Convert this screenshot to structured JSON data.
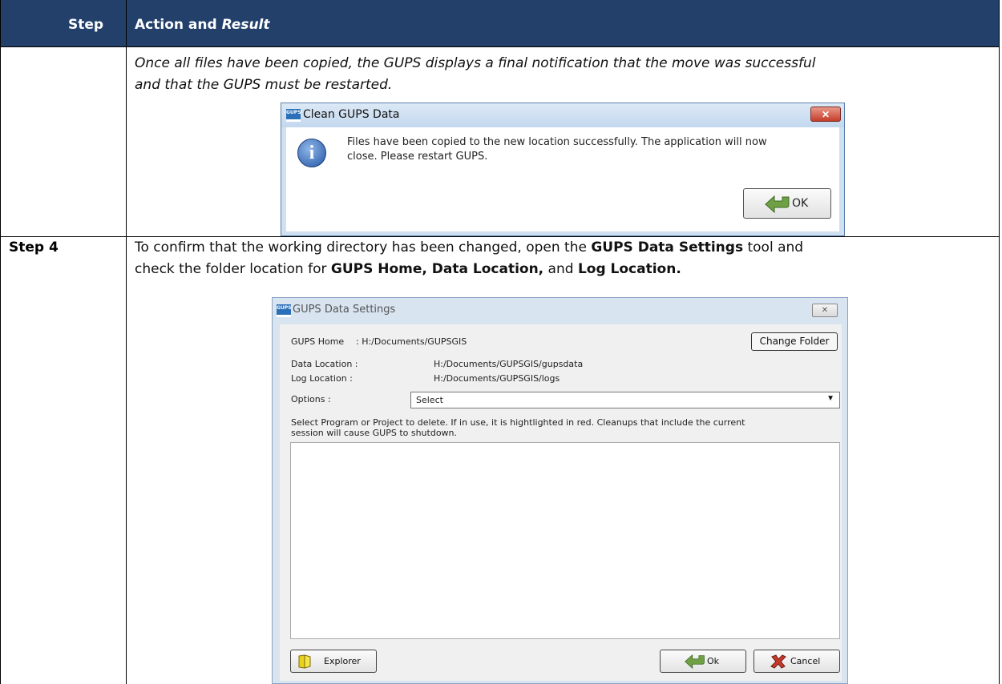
{
  "table": {
    "header": {
      "step": "Step",
      "action": "Action and",
      "result": "Result"
    },
    "row1": {
      "text_line1": "Once all files have been copied, the GUPS displays a final notification that the move was successful",
      "text_line2": "and that the GUPS must be restarted."
    },
    "row2": {
      "step": "Step 4",
      "text_line1_a": "To confirm that the working directory has been changed, open the ",
      "text_line1_b": "GUPS Data Settings",
      "text_line1_c": " tool and",
      "text_line2_a": "check the folder location for ",
      "text_line2_b": "GUPS Home, Data Location,",
      "text_line2_c": " and ",
      "text_line2_d": "Log Location."
    }
  },
  "dialog_clean": {
    "title": "Clean GUPS Data",
    "close": "✕",
    "message_line1": "Files have been copied to the new location successfully. The application will now",
    "message_line2": "close. Please restart GUPS.",
    "ok": "OK"
  },
  "dialog_settings": {
    "title": "GUPS Data Settings",
    "close": "✕",
    "gups_home_label": "GUPS Home",
    "gups_home_value": ": H:/Documents/GUPSGIS",
    "change_folder": "Change Folder",
    "data_location_label": "Data Location  :",
    "data_location_value": "H:/Documents/GUPSGIS/gupsdata",
    "log_location_label": "Log Location   :",
    "log_location_value": "H:/Documents/GUPSGIS/logs",
    "options_label": "Options :",
    "options_value": "Select",
    "note_line1": "Select Program or Project to delete. If in use, it is hightlighted in red. Cleanups that include the current",
    "note_line2": "session will cause GUPS to shutdown.",
    "explorer": "Explorer",
    "ok": "Ok",
    "cancel": "Cancel"
  },
  "icons": {
    "gups": "GUPS"
  },
  "colors": {
    "header_bg": "#22406a",
    "header_text": "#ffffff"
  }
}
